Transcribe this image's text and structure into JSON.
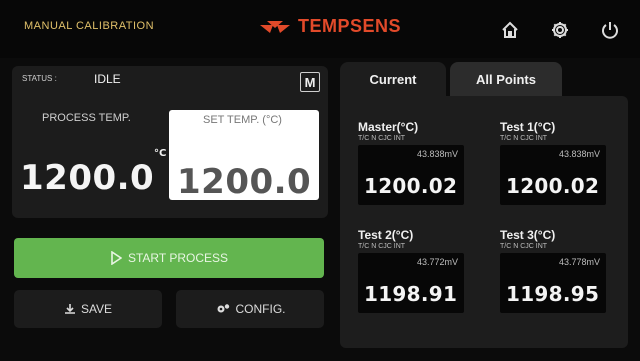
{
  "header": {
    "title": "MANUAL CALIBRATION",
    "brand": "TEMPSENS",
    "brand_color": "#e24a2a",
    "icons": [
      "home-icon",
      "gear-icon",
      "power-icon"
    ]
  },
  "status": {
    "label": "STATUS :",
    "value": "IDLE",
    "mode": "M"
  },
  "process": {
    "label": "PROCESS TEMP.",
    "value": "1200.0",
    "unit": "°C"
  },
  "setpoint": {
    "label": "SET TEMP. (°C)",
    "value": "1200.0"
  },
  "buttons": {
    "start": "START PROCESS",
    "save": "SAVE",
    "config": "CONFIG.",
    "start_color": "#63b54f"
  },
  "tabs": {
    "current": "Current",
    "all_points": "All Points"
  },
  "cards": [
    {
      "title": "Master(°C)",
      "sub": "T/C N CJC INT",
      "mv": "43.838mV",
      "value": "1200.02"
    },
    {
      "title": "Test 1(°C)",
      "sub": "T/C N CJC INT",
      "mv": "43.838mV",
      "value": "1200.02"
    },
    {
      "title": "Test 2(°C)",
      "sub": "T/C N CJC INT",
      "mv": "43.772mV",
      "value": "1198.91"
    },
    {
      "title": "Test 3(°C)",
      "sub": "T/C N CJC INT",
      "mv": "43.778mV",
      "value": "1198.95"
    }
  ]
}
